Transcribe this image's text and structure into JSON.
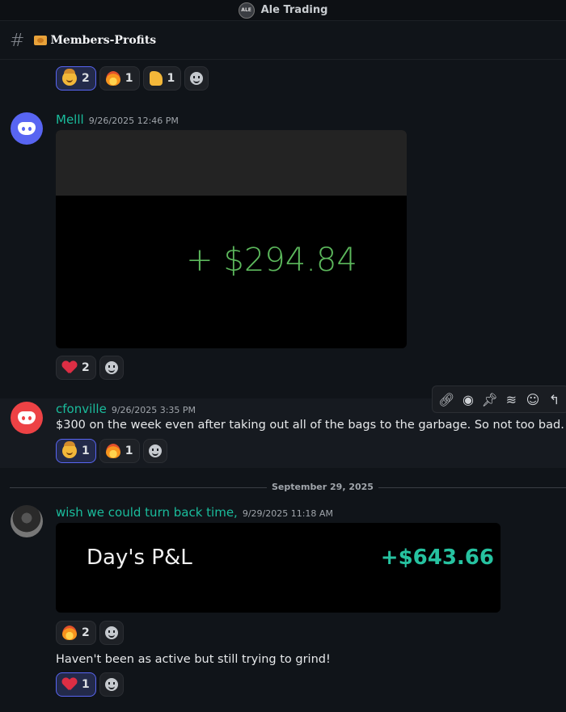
{
  "server": {
    "name": "Ale Trading",
    "icon_text": "ALE"
  },
  "channel": {
    "name": "Members-Profits"
  },
  "top_reactions": [
    {
      "emoji": "cowboy-face",
      "count": "2"
    },
    {
      "emoji": "fire",
      "count": "1"
    },
    {
      "emoji": "thumbs-up",
      "count": "1"
    }
  ],
  "messages": [
    {
      "author": "Melll",
      "timestamp": "9/26/2025 12:46 PM",
      "image_value": "+ $294.84",
      "reactions": [
        {
          "emoji": "heart",
          "count": "2"
        }
      ]
    },
    {
      "author": "cfonville",
      "timestamp": "9/26/2025 3:35 PM",
      "text": "$300 on the week even after taking out all of the bags to the garbage.  So not too bad.",
      "reactions": [
        {
          "emoji": "cowboy-face",
          "count": "1"
        },
        {
          "emoji": "fire",
          "count": "1"
        }
      ]
    },
    {
      "author": "wish we could turn back time,",
      "timestamp": "9/29/2025 11:18 AM",
      "image_label": "Day's P&L",
      "image_value": "+$643.66",
      "reactions": [
        {
          "emoji": "fire",
          "count": "2"
        }
      ],
      "text2": "Haven't been as active but still trying to grind!",
      "reactions2": [
        {
          "emoji": "heart",
          "count": "1"
        }
      ]
    }
  ],
  "date_divider": "September 29, 2025",
  "colors": {
    "accent": "#5865f2",
    "username": "#1abc9c",
    "profit_green": "#5cb85c",
    "profit_teal": "#26c2a0"
  }
}
